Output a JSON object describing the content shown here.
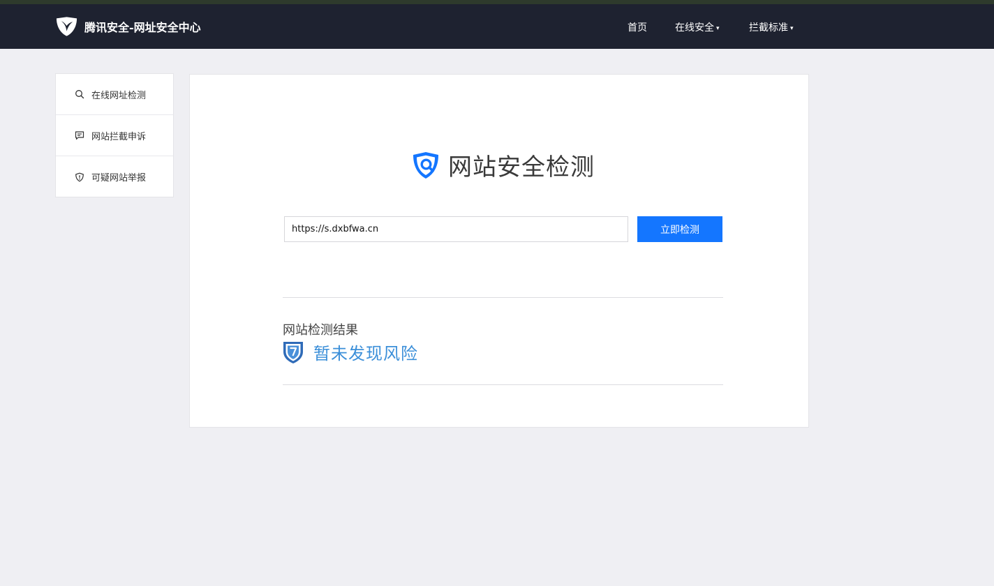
{
  "header": {
    "brand_title": "腾讯安全-网址安全中心",
    "nav": [
      {
        "label": "首页",
        "caret": ""
      },
      {
        "label": "在线安全",
        "caret": "▾"
      },
      {
        "label": "拦截标准",
        "caret": "▾"
      }
    ]
  },
  "sidebar": {
    "items": [
      {
        "label": "在线网址检测",
        "icon": "search-icon"
      },
      {
        "label": "网站拦截申诉",
        "icon": "message-icon"
      },
      {
        "label": "可疑网站举报",
        "icon": "shield-alert-icon"
      }
    ]
  },
  "main": {
    "title": "网站安全检测",
    "url_value": "https://s.dxbfwa.cn",
    "check_button": "立即检测",
    "result_label": "网站检测结果",
    "result_text": "暂未发现风险"
  },
  "colors": {
    "header_bg": "#1e2230",
    "accent": "#1476ff",
    "result_blue": "#3b8fd9"
  }
}
